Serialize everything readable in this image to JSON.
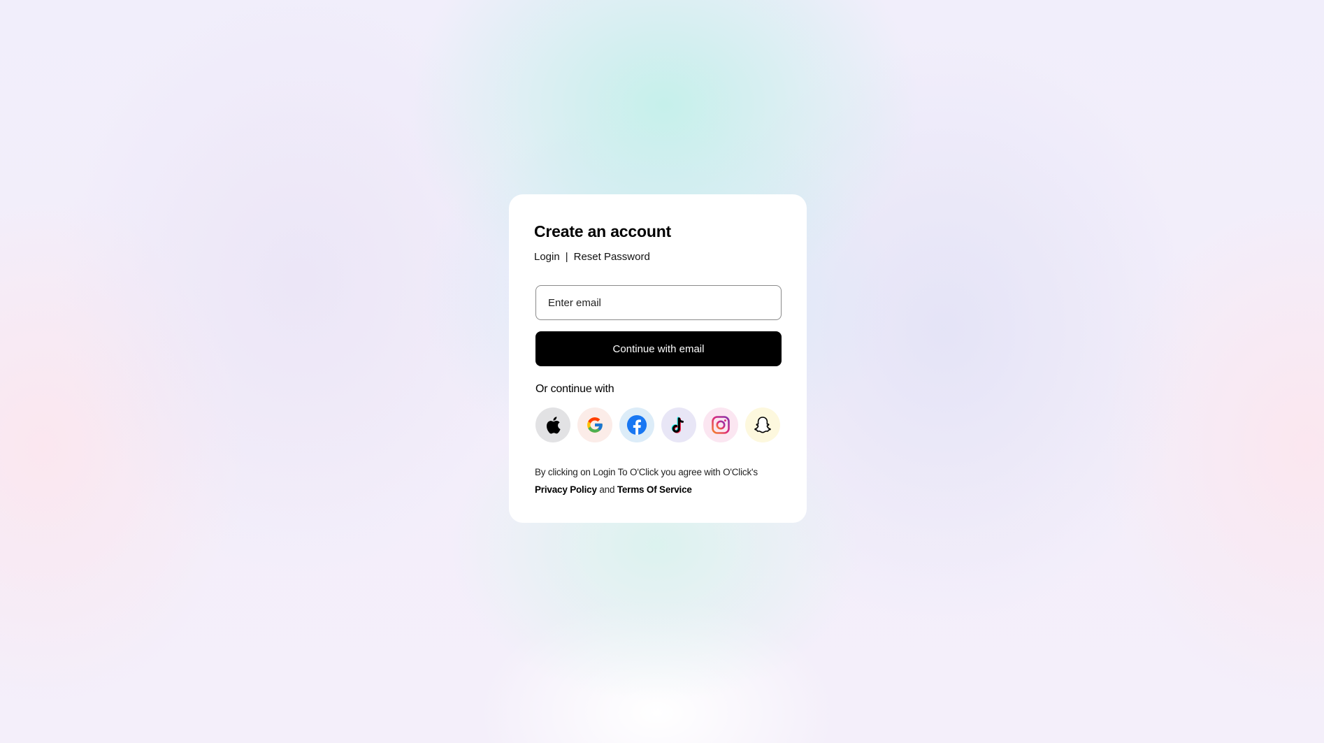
{
  "card": {
    "title": "Create an account",
    "links": {
      "login": "Login",
      "separator": "|",
      "reset_password": "Reset Password"
    },
    "email": {
      "placeholder": "Enter email",
      "value": ""
    },
    "continue_button": "Continue with email",
    "or_label": "Or continue with",
    "social_providers": [
      {
        "name": "Apple",
        "icon": "apple-icon"
      },
      {
        "name": "Google",
        "icon": "google-icon"
      },
      {
        "name": "Facebook",
        "icon": "facebook-icon"
      },
      {
        "name": "TikTok",
        "icon": "tiktok-icon"
      },
      {
        "name": "Instagram",
        "icon": "instagram-icon"
      },
      {
        "name": "Snapchat",
        "icon": "snapchat-icon"
      }
    ],
    "terms": {
      "prefix": "By clicking on Login To O'Click you agree with O'Click's",
      "privacy_policy": "Privacy Policy",
      "and": "and",
      "terms_of_service": "Terms Of Service"
    }
  },
  "colors": {
    "button_bg": "#000000",
    "card_bg": "#ffffff",
    "facebook_blue": "#1877F2",
    "instagram_gradient": [
      "#F58529",
      "#DD2A7B",
      "#8134AF"
    ]
  }
}
